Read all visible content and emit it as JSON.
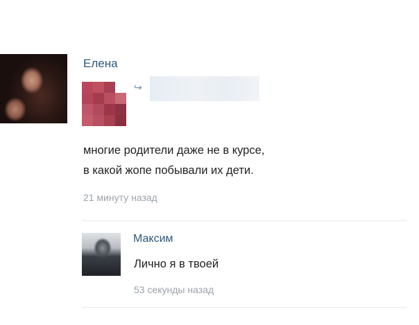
{
  "post": {
    "author": "Елена",
    "repost_icon": "repost-arrow-icon",
    "text": "многие родители даже не в курсе,\nв какой жопе побывали их дети.",
    "time": "21 минуту назад"
  },
  "comment": {
    "author": "Максим",
    "text": "Лично я в твоей",
    "time": "53 секунды назад"
  },
  "colors": {
    "name_link": "#2b587a",
    "timestamp": "#9aa2ab",
    "text": "#222222",
    "thumb_palette": [
      "#b8485a",
      "#a43c4f",
      "#8f3344",
      "#c35f6e"
    ]
  }
}
